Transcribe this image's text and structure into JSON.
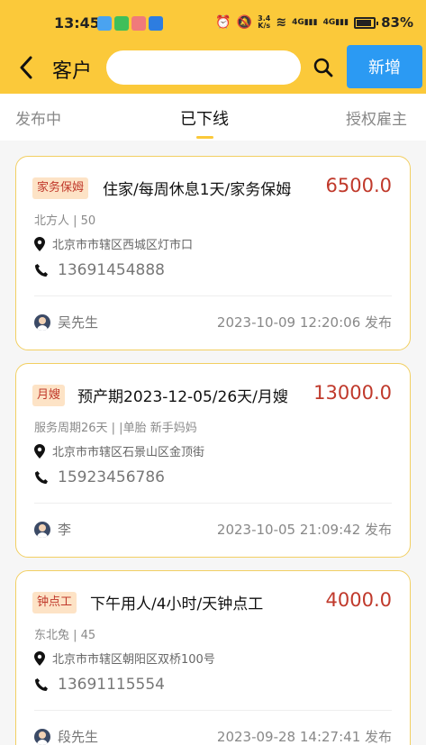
{
  "status_bar": {
    "time": "13:45",
    "speed_value": "3.4",
    "speed_unit": "K/s",
    "net1": "4G",
    "net2": "4G",
    "battery": "83%"
  },
  "header": {
    "title": "客户",
    "search_placeholder": "",
    "add_label": "新增"
  },
  "tabs": [
    {
      "label": "发布中",
      "active": false
    },
    {
      "label": "已下线",
      "active": true
    },
    {
      "label": "授权雇主",
      "active": false
    }
  ],
  "cards": [
    {
      "tag": "家务保姆",
      "title": "住家/每周休息1天/家务保姆",
      "price": "6500.0",
      "meta": "北方人 | 50",
      "address": "北京市市辖区西城区灯市口",
      "phone": "13691454888",
      "user": "吴先生",
      "timestamp": "2023-10-09 12:20:06 发布"
    },
    {
      "tag": "月嫂",
      "title": "预产期2023-12-05/26天/月嫂",
      "price": "13000.0",
      "meta": "服务周期26天 | |单胎 新手妈妈",
      "address": "北京市市辖区石景山区金顶街",
      "phone": "15923456786",
      "user": "李",
      "timestamp": "2023-10-05 21:09:42 发布"
    },
    {
      "tag": "钟点工",
      "title": "下午用人/4小时/天钟点工",
      "price": "4000.0",
      "meta": "东北兔 | 45",
      "address": "北京市市辖区朝阳区双桥100号",
      "phone": "13691115554",
      "user": "段先生",
      "timestamp": "2023-09-28 14:27:41 发布"
    }
  ],
  "colors": {
    "brand_yellow": "#fbc93a",
    "price_red": "#c0392b",
    "add_button_blue": "#2b9af3"
  }
}
